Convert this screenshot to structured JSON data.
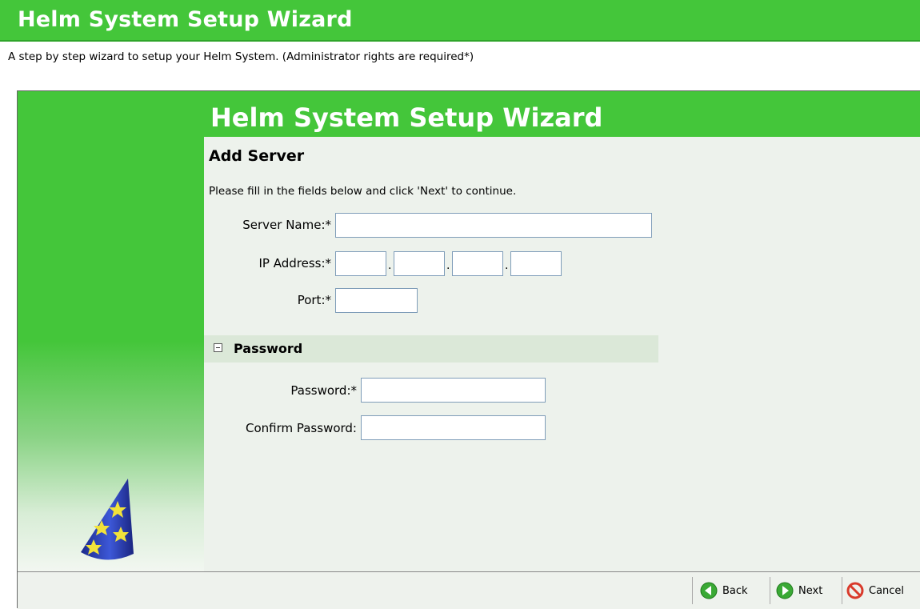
{
  "banner": {
    "title": "Helm System Setup Wizard"
  },
  "subtitle": "A step by step wizard to setup your Helm System. (Administrator rights are required*)",
  "wizard": {
    "title": "Helm System Setup Wizard",
    "section_title": "Add Server",
    "instructions": "Please fill in the fields below and click 'Next' to continue.",
    "fields": {
      "server_name": {
        "label": "Server Name:*",
        "value": ""
      },
      "ip_address": {
        "label": "IP Address:*",
        "octets": [
          "",
          "",
          "",
          ""
        ],
        "separator": "."
      },
      "port": {
        "label": "Port:*",
        "value": ""
      }
    },
    "password_section": {
      "title": "Password",
      "toggle_icon": "collapse-minus-icon",
      "password": {
        "label": "Password:*",
        "value": ""
      },
      "confirm": {
        "label": "Confirm Password:",
        "value": ""
      }
    },
    "icons": {
      "wizard_hat": "wizard-hat-icon"
    },
    "footer": {
      "back": {
        "label": "Back",
        "icon": "back-arrow-icon"
      },
      "next": {
        "label": "Next",
        "icon": "next-arrow-icon"
      },
      "cancel": {
        "label": "Cancel",
        "icon": "cancel-icon"
      }
    }
  },
  "colors": {
    "accent": "#44c63a",
    "panel_bg": "#edf2ec",
    "section_header_bg": "#dbe8d8"
  }
}
